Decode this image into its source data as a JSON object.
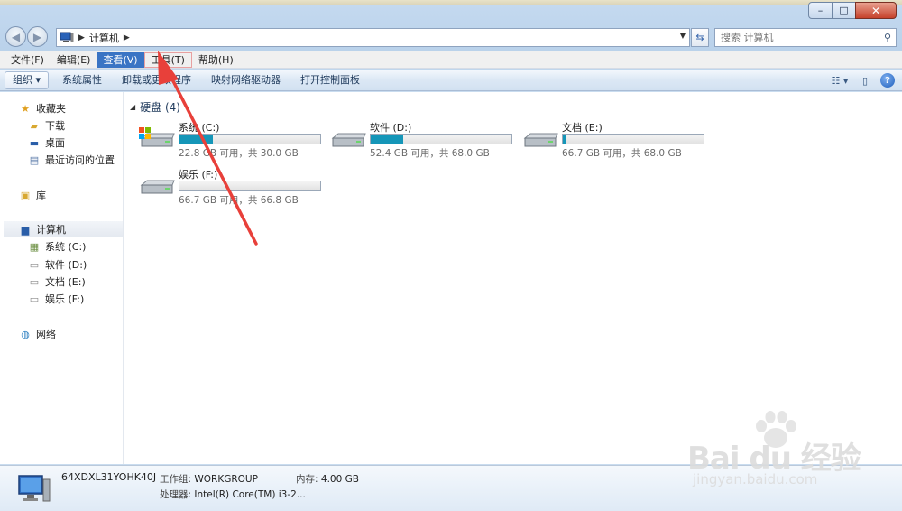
{
  "window": {
    "min_glyph": "–",
    "max_glyph": "□",
    "close_glyph": "✕"
  },
  "address": {
    "crumb": "计算机",
    "search_placeholder": "搜索 计算机"
  },
  "menu": [
    "文件(F)",
    "编辑(E)",
    "查看(V)",
    "工具(T)",
    "帮助(H)"
  ],
  "menu_active_index": 2,
  "commands": {
    "organize": "组织 ▾",
    "items": [
      "系统属性",
      "卸载或更改程序",
      "映射网络驱动器",
      "打开控制面板"
    ]
  },
  "nav": {
    "favorites": "收藏夹",
    "downloads": "下载",
    "desktop": "桌面",
    "recent": "最近访问的位置",
    "libraries": "库",
    "computer": "计算机",
    "drive_c": "系统 (C:)",
    "drive_d": "软件 (D:)",
    "drive_e": "文档 (E:)",
    "drive_f": "娱乐 (F:)",
    "network": "网络"
  },
  "content": {
    "group_title": "硬盘 (4)",
    "drives": [
      {
        "name": "系统 (C:)",
        "free": "22.8 GB 可用，共 30.0 GB",
        "used_fraction": 0.24,
        "has_windows_logo": true
      },
      {
        "name": "软件 (D:)",
        "free": "52.4 GB 可用，共 68.0 GB",
        "used_fraction": 0.23,
        "has_windows_logo": false
      },
      {
        "name": "文档 (E:)",
        "free": "66.7 GB 可用，共 68.0 GB",
        "used_fraction": 0.02,
        "has_windows_logo": false
      },
      {
        "name": "娱乐 (F:)",
        "free": "66.7 GB 可用，共 66.8 GB",
        "used_fraction": 0.0,
        "has_windows_logo": false
      }
    ]
  },
  "details": {
    "pc_name": "64XDXL31YOHK40J",
    "workgroup_label": "工作组:",
    "workgroup_value": "WORKGROUP",
    "memory_label": "内存:",
    "memory_value": "4.00 GB",
    "cpu_label": "处理器:",
    "cpu_value": "Intel(R) Core(TM) i3-2..."
  },
  "watermark": {
    "brand": "Bai du 经验",
    "url": "jingyan.baidu.com"
  },
  "colors": {
    "annotation_arrow": "#e8403a",
    "bar_fill": "#1596b8",
    "menu_active": "#3a74c4"
  }
}
